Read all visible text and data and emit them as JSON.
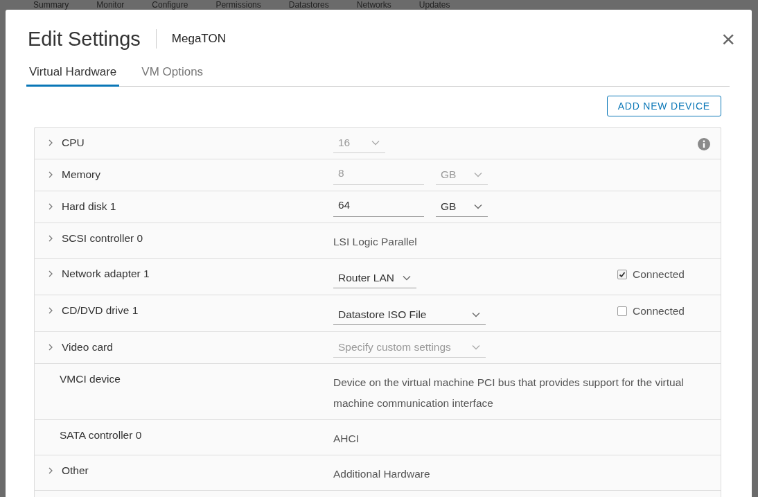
{
  "background_tabs": [
    "Summary",
    "Monitor",
    "Configure",
    "Permissions",
    "Datastores",
    "Networks",
    "Updates"
  ],
  "dialog": {
    "title": "Edit Settings",
    "subtitle": "MegaTON",
    "close": "×"
  },
  "tabs": [
    {
      "label": "Virtual Hardware",
      "selected": true
    },
    {
      "label": "VM Options",
      "selected": false
    }
  ],
  "add_button": "ADD NEW DEVICE",
  "rows": [
    {
      "kind": "select",
      "label": "CPU",
      "expandable": true,
      "value": "16",
      "disabled": true,
      "info": true
    },
    {
      "kind": "input_unit",
      "label": "Memory",
      "expandable": true,
      "value": "8",
      "unit": "GB",
      "disabled": true
    },
    {
      "kind": "input_unit",
      "label": "Hard disk 1",
      "expandable": true,
      "value": "64",
      "unit": "GB",
      "disabled": false
    },
    {
      "kind": "text",
      "label": "SCSI controller 0",
      "expandable": true,
      "value": "LSI Logic Parallel"
    },
    {
      "kind": "select_check",
      "label": "Network adapter 1",
      "expandable": true,
      "value": "Router LAN",
      "check_label": "Connected",
      "checked": true
    },
    {
      "kind": "select_check",
      "label": "CD/DVD drive 1",
      "expandable": true,
      "value": "Datastore ISO File",
      "check_label": "Connected",
      "checked": false,
      "wide": true
    },
    {
      "kind": "select",
      "label": "Video card",
      "expandable": true,
      "value": "Specify custom settings",
      "disabled": true,
      "wide": true
    },
    {
      "kind": "text",
      "label": "VMCI device",
      "expandable": false,
      "value": "Device on the virtual machine PCI bus that provides support for the virtual machine communication interface"
    },
    {
      "kind": "text",
      "label": "SATA controller 0",
      "expandable": false,
      "value": "AHCI"
    },
    {
      "kind": "text",
      "label": "Other",
      "expandable": true,
      "value": "Additional Hardware"
    }
  ]
}
